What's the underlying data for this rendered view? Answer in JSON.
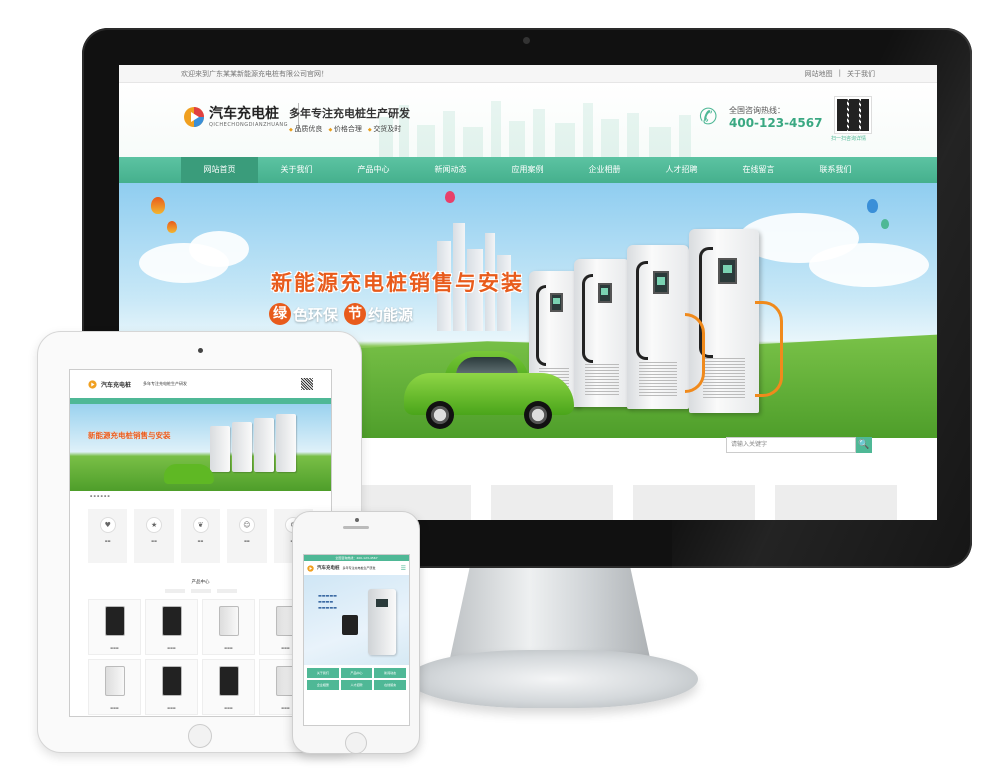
{
  "desktop": {
    "topbar": {
      "welcome": "欢迎来到广东某某新能源充电桩有限公司官网！",
      "links": [
        "网站地图",
        "关于我们"
      ]
    },
    "logo": {
      "name": "汽车充电桩",
      "pinyin": "QICHECHONGDIANZHUANG"
    },
    "slogan": {
      "main": "多年专注充电桩生产研发",
      "tags": [
        "品质优良",
        "价格合理",
        "交货及时"
      ]
    },
    "hotline": {
      "label": "全国咨询热线：",
      "number": "400-123-4567"
    },
    "qr_label": "扫一扫咨询详情",
    "nav": [
      "网站首页",
      "关于我们",
      "产品中心",
      "新闻动态",
      "应用案例",
      "企业相册",
      "人才招聘",
      "在线留言",
      "联系我们"
    ],
    "banner": {
      "title": "新能源充电桩销售与安装",
      "subtitle": [
        {
          "badge": "绿",
          "text": "色环保"
        },
        {
          "badge": "节",
          "text": "约能源"
        }
      ]
    },
    "search": {
      "placeholder": "请输入关键字",
      "button": "🔍"
    }
  },
  "tablet": {
    "logo": "汽车充电桩",
    "slogan": "多年专注充电桩生产研发",
    "banner_title": "新能源充电桩销售与安装",
    "section_title": "产品中心"
  },
  "phone": {
    "top": "全国咨询热线：400-123-4567",
    "logo": "汽车充电桩",
    "slogan": "多年专注充电桩生产研发",
    "nav": [
      "关于我们",
      "产品中心",
      "新闻动态",
      "企业相册",
      "人才招聘",
      "在线留言"
    ]
  },
  "colors": {
    "brand": "#4fb896",
    "accent": "#e85b1c",
    "bezel": "#111111"
  }
}
